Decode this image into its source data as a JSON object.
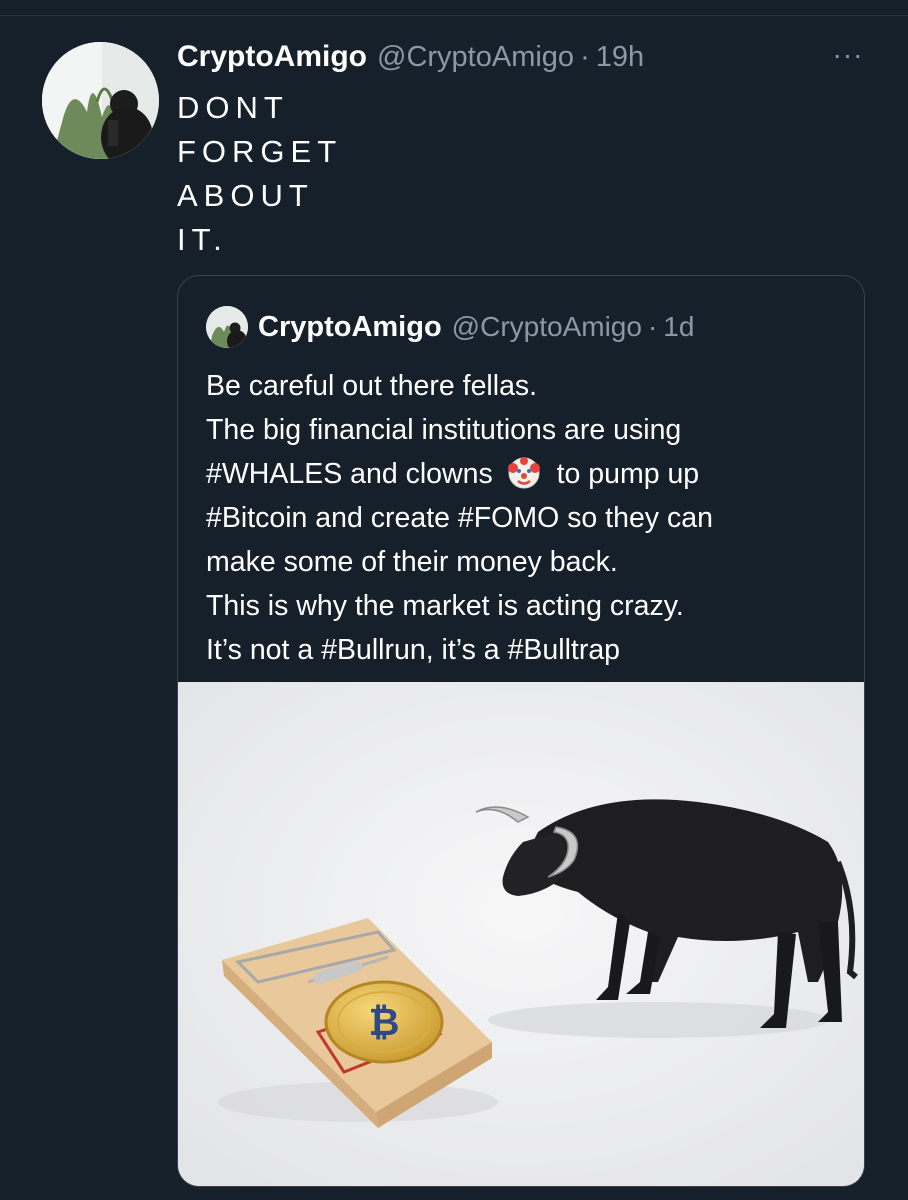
{
  "tweet": {
    "author_name": "CryptoAmigo",
    "author_handle": "@CryptoAmigo",
    "separator": "·",
    "time": "19h",
    "more_icon": "more-options-icon",
    "more_label": "···",
    "lines": [
      "DONT",
      "FORGET",
      "ABOUT",
      "IT."
    ]
  },
  "quoted_tweet": {
    "author_name": "CryptoAmigo",
    "author_handle": "@CryptoAmigo",
    "separator": "·",
    "time": "1d",
    "lines": [
      "Be careful out there fellas.",
      "The big financial institutions are using",
      "#WHALES and clowns",
      "to pump up",
      "#Bitcoin and create #FOMO so they can",
      "make some of their money back.",
      "This is why the market is acting crazy.",
      "It’s not a #Bullrun, it’s a #Bulltrap"
    ],
    "emoji": "clown-face-emoji",
    "media": {
      "description_icon": "bull-and-bitcoin-mousetrap-image",
      "coin_symbol": "₿"
    }
  },
  "colors": {
    "background": "#15202b",
    "text": "#ffffff",
    "secondary": "#8b98a5",
    "border": "#38444d"
  }
}
